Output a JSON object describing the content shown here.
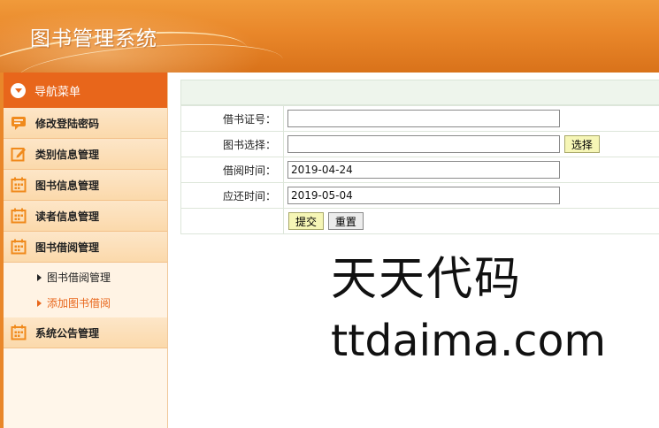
{
  "app": {
    "title": "图书管理系统"
  },
  "sidebar": {
    "nav_header": "导航菜单",
    "items": [
      {
        "label": "修改登陆密码",
        "icon": "message-icon"
      },
      {
        "label": "类别信息管理",
        "icon": "edit-icon"
      },
      {
        "label": "图书信息管理",
        "icon": "calendar-icon"
      },
      {
        "label": "读者信息管理",
        "icon": "calendar-icon"
      },
      {
        "label": "图书借阅管理",
        "icon": "calendar-icon"
      },
      {
        "label": "系统公告管理",
        "icon": "calendar-icon"
      }
    ],
    "sub_items": [
      {
        "label": "图书借阅管理",
        "active": false
      },
      {
        "label": "添加图书借阅",
        "active": true
      }
    ]
  },
  "form": {
    "card_label": "借书证号：",
    "card_value": "",
    "book_label": "图书选择：",
    "book_value": "",
    "select_button": "选择",
    "borrow_label": "借阅时间：",
    "borrow_value": "2019-04-24",
    "return_label": "应还时间：",
    "return_value": "2019-05-04",
    "submit_button": "提交",
    "reset_button": "重置"
  },
  "watermark": {
    "line1": "天天代码",
    "line2": "ttdaima.com"
  },
  "colors": {
    "accent": "#e8661b",
    "header": "#e9872a",
    "menu_bg": "#fbd9ab"
  }
}
